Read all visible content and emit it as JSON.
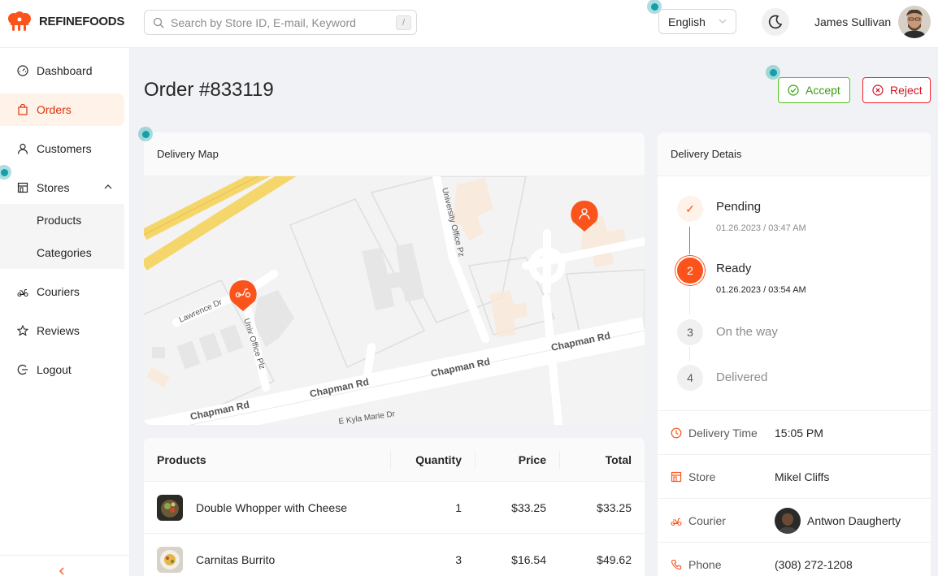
{
  "brand": {
    "name": "REFINEFOODS",
    "accent": "#fa541c"
  },
  "header": {
    "search_placeholder": "Search by Store ID, E-mail, Keyword",
    "search_shortcut": "/",
    "language": "English",
    "user_name": "James Sullivan"
  },
  "sidebar": {
    "items": [
      {
        "label": "Dashboard",
        "icon": "dashboard-icon"
      },
      {
        "label": "Orders",
        "icon": "shopping-bag-icon",
        "active": true
      },
      {
        "label": "Customers",
        "icon": "user-icon"
      },
      {
        "label": "Stores",
        "icon": "store-icon",
        "expanded": true
      },
      {
        "label": "Couriers",
        "icon": "scooter-icon"
      },
      {
        "label": "Reviews",
        "icon": "star-icon"
      },
      {
        "label": "Logout",
        "icon": "logout-icon"
      }
    ],
    "sub_items": [
      {
        "label": "Products"
      },
      {
        "label": "Categories"
      }
    ]
  },
  "order": {
    "title": "Order #833119",
    "accept_label": "Accept",
    "reject_label": "Reject"
  },
  "map": {
    "title": "Delivery Map",
    "streets": [
      "Chapman Rd",
      "Chapman Rd",
      "Chapman Rd",
      "Chapman Rd",
      "Lawrence Dr",
      "Univ Office Plz",
      "University Office Pz",
      "E Kyla Marie Dr"
    ]
  },
  "products": {
    "headers": {
      "product": "Products",
      "quantity": "Quantity",
      "price": "Price",
      "total": "Total"
    },
    "rows": [
      {
        "name": "Double Whopper with Cheese",
        "quantity": "1",
        "price": "$33.25",
        "total": "$33.25"
      },
      {
        "name": "Carnitas Burrito",
        "quantity": "3",
        "price": "$16.54",
        "total": "$49.62"
      }
    ]
  },
  "delivery": {
    "title": "Delivery Detais",
    "steps": [
      {
        "marker": "✓",
        "title": "Pending",
        "time": "01.26.2023 / 03:47 AM"
      },
      {
        "marker": "2",
        "title": "Ready",
        "time": "01.26.2023 / 03:54 AM"
      },
      {
        "marker": "3",
        "title": "On the way",
        "time": ""
      },
      {
        "marker": "4",
        "title": "Delivered",
        "time": ""
      }
    ],
    "info": {
      "delivery_time_label": "Delivery Time",
      "delivery_time": "15:05 PM",
      "store_label": "Store",
      "store": "Mikel Cliffs",
      "courier_label": "Courier",
      "courier": "Antwon Daugherty",
      "phone_label": "Phone",
      "phone": "(308) 272-1208"
    }
  }
}
